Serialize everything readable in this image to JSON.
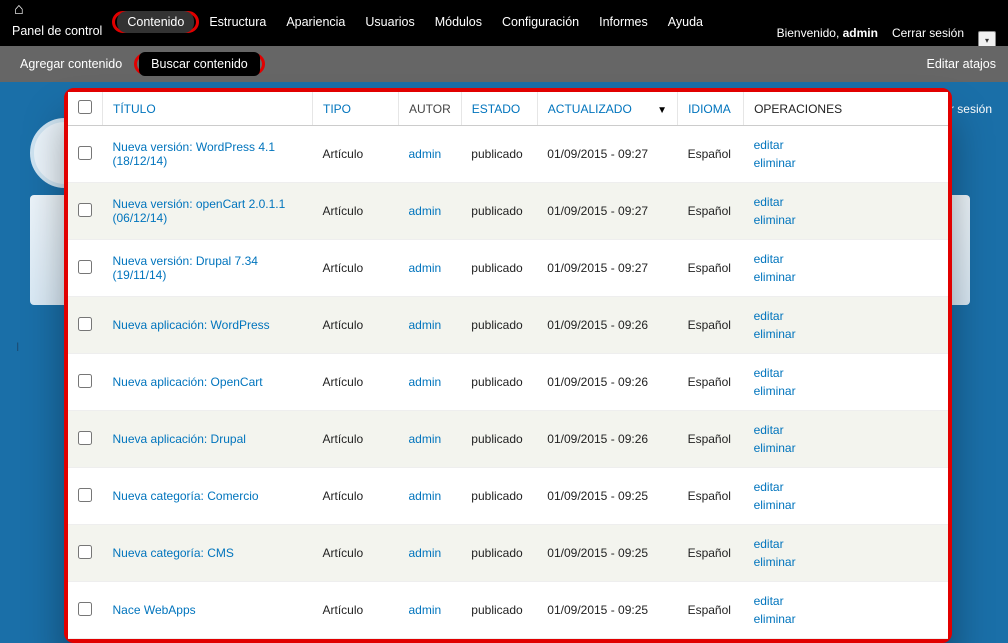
{
  "topbar": {
    "home_icon": "⌂",
    "panel_de_control": "Panel de control",
    "contenido": "Contenido",
    "estructura": "Estructura",
    "apariencia": "Apariencia",
    "usuarios": "Usuarios",
    "modulos": "Módulos",
    "configuracion": "Configuración",
    "informes": "Informes",
    "ayuda": "Ayuda",
    "welcome_prefix": "Bienvenido, ",
    "welcome_user": "admin",
    "logout": "Cerrar sesión"
  },
  "subbar": {
    "agregar": "Agregar contenido",
    "buscar": "Buscar contenido",
    "edit": "Editar atajos"
  },
  "bg": {
    "r_sesion": "r sesión",
    "left_i": "I"
  },
  "headers": {
    "titulo": "TÍTULO",
    "tipo": "TIPO",
    "autor": "AUTOR",
    "estado": "ESTADO",
    "actualizado": "ACTUALIZADO",
    "idioma": "IDIOMA",
    "operaciones": "OPERACIONES"
  },
  "op_labels": {
    "editar": "editar",
    "eliminar": "eliminar"
  },
  "rows": [
    {
      "title": "Nueva versión: WordPress 4.1 (18/12/14)",
      "tipo": "Artículo",
      "autor": "admin",
      "estado": "publicado",
      "actualizado": "01/09/2015 - 09:27",
      "idioma": "Español"
    },
    {
      "title": "Nueva versión: openCart 2.0.1.1 (06/12/14)",
      "tipo": "Artículo",
      "autor": "admin",
      "estado": "publicado",
      "actualizado": "01/09/2015 - 09:27",
      "idioma": "Español"
    },
    {
      "title": "Nueva versión: Drupal 7.34 (19/11/14)",
      "tipo": "Artículo",
      "autor": "admin",
      "estado": "publicado",
      "actualizado": "01/09/2015 - 09:27",
      "idioma": "Español"
    },
    {
      "title": "Nueva aplicación: WordPress",
      "tipo": "Artículo",
      "autor": "admin",
      "estado": "publicado",
      "actualizado": "01/09/2015 - 09:26",
      "idioma": "Español"
    },
    {
      "title": "Nueva aplicación: OpenCart",
      "tipo": "Artículo",
      "autor": "admin",
      "estado": "publicado",
      "actualizado": "01/09/2015 - 09:26",
      "idioma": "Español"
    },
    {
      "title": "Nueva aplicación: Drupal",
      "tipo": "Artículo",
      "autor": "admin",
      "estado": "publicado",
      "actualizado": "01/09/2015 - 09:26",
      "idioma": "Español"
    },
    {
      "title": "Nueva categoría: Comercio",
      "tipo": "Artículo",
      "autor": "admin",
      "estado": "publicado",
      "actualizado": "01/09/2015 - 09:25",
      "idioma": "Español"
    },
    {
      "title": "Nueva categoría: CMS",
      "tipo": "Artículo",
      "autor": "admin",
      "estado": "publicado",
      "actualizado": "01/09/2015 - 09:25",
      "idioma": "Español"
    },
    {
      "title": "Nace WebApps",
      "tipo": "Artículo",
      "autor": "admin",
      "estado": "publicado",
      "actualizado": "01/09/2015 - 09:25",
      "idioma": "Español"
    }
  ]
}
